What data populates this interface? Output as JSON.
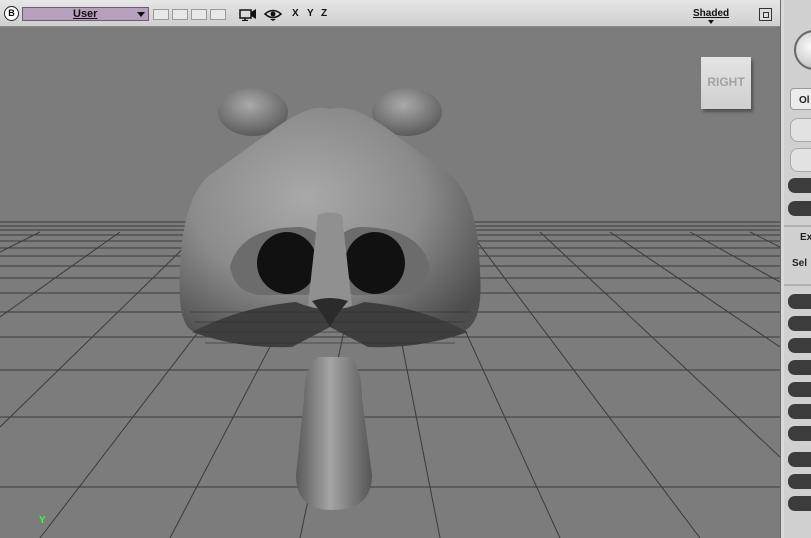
{
  "toolbar": {
    "logo": "B",
    "view_select": "User",
    "axes": [
      "X",
      "Y",
      "Z"
    ],
    "shading": "Shaded",
    "icons": [
      "camera-icon",
      "eye-icon",
      "maximize-icon"
    ]
  },
  "viewport": {
    "nav_cube_label": "RIGHT",
    "axis_indicator": "Y",
    "colors": {
      "background": "#7c7c7c",
      "grid": "#3a3a3a",
      "model": "#8a8a8a",
      "axis": "#3dff3d"
    }
  },
  "right_panel": {
    "tab_label": "Ol",
    "expand_label": "Ex",
    "select_label": "Sel"
  }
}
